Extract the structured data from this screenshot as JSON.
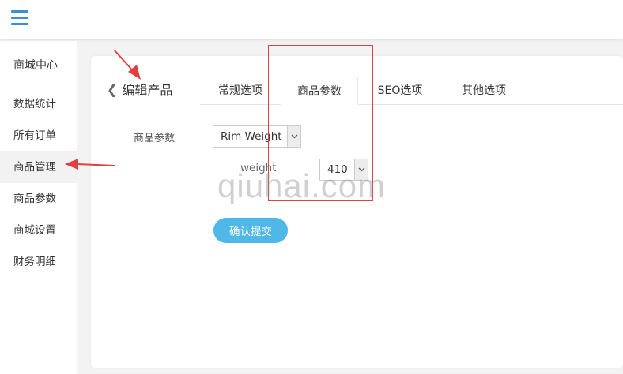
{
  "header": {
    "menu_icon": "hamburger-menu-icon"
  },
  "sidebar": {
    "title": "商城中心",
    "items": [
      {
        "label": "数据统计"
      },
      {
        "label": "所有订单"
      },
      {
        "label": "商品管理",
        "active": true
      },
      {
        "label": "商品参数"
      },
      {
        "label": "商城设置"
      },
      {
        "label": "财务明细"
      }
    ]
  },
  "panel": {
    "back_icon": "chevron-left-icon",
    "title": "编辑产品",
    "tabs": [
      {
        "label": "常规选项"
      },
      {
        "label": "商品参数",
        "active": true
      },
      {
        "label": "SEO选项"
      },
      {
        "label": "其他选项"
      }
    ]
  },
  "form": {
    "param_label": "商品参数",
    "param_select_value": "Rim Weight",
    "weight_label": "weight",
    "weight_select_value": "410",
    "submit_label": "确认提交"
  },
  "overlay": {
    "watermark": "qiuhai.com",
    "annotation_color": "#e04040"
  }
}
